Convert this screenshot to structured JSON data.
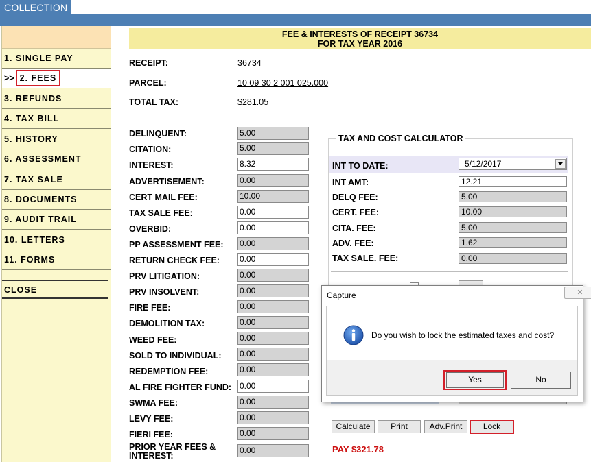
{
  "app_tab": "COLLECTION",
  "sidebar": {
    "items": [
      {
        "label": "1. SINGLE PAY"
      },
      {
        "prefix": ">>",
        "label": "2. FEES"
      },
      {
        "label": "3. REFUNDS"
      },
      {
        "label": "4. TAX BILL"
      },
      {
        "label": "5. HISTORY"
      },
      {
        "label": "6. ASSESSMENT"
      },
      {
        "label": "7. TAX SALE"
      },
      {
        "label": "8. DOCUMENTS"
      },
      {
        "label": "9. AUDIT TRAIL"
      },
      {
        "label": "10. LETTERS"
      },
      {
        "label": "11. FORMS"
      }
    ],
    "close_label": "CLOSE"
  },
  "header": {
    "line1": "FEE & INTERESTS OF RECEIPT 36734",
    "line2": "FOR TAX YEAR 2016"
  },
  "info": {
    "receipt_label": "RECEIPT:",
    "receipt_value": "36734",
    "parcel_label": "PARCEL:",
    "parcel_value": "10 09 30 2 001 025.000",
    "total_tax_label": "TOTAL TAX:",
    "total_tax_value": "$281.05"
  },
  "fees": [
    {
      "label": "DELINQUENT:",
      "value": "5.00"
    },
    {
      "label": "CITATION:",
      "value": "5.00"
    },
    {
      "label": "INTEREST:",
      "value": "8.32"
    },
    {
      "label": "ADVERTISEMENT:",
      "value": "0.00"
    },
    {
      "label": "CERT MAIL FEE:",
      "value": "10.00"
    },
    {
      "label": "TAX SALE FEE:",
      "value": "0.00"
    },
    {
      "label": "OVERBID:",
      "value": "0.00"
    },
    {
      "label": "PP ASSESSMENT FEE:",
      "value": "0.00"
    },
    {
      "label": "RETURN CHECK FEE:",
      "value": "0.00"
    },
    {
      "label": "PRV LITIGATION:",
      "value": "0.00"
    },
    {
      "label": "PRV INSOLVENT:",
      "value": "0.00"
    },
    {
      "label": "FIRE FEE:",
      "value": "0.00"
    },
    {
      "label": "DEMOLITION TAX:",
      "value": "0.00"
    },
    {
      "label": "WEED FEE:",
      "value": "0.00"
    },
    {
      "label": "SOLD TO INDIVIDUAL:",
      "value": "0.00"
    },
    {
      "label": "REDEMPTION FEE:",
      "value": "0.00"
    },
    {
      "label": "AL FIRE FIGHTER FUND:",
      "value": "0.00"
    },
    {
      "label": "SWMA FEE:",
      "value": "0.00"
    },
    {
      "label": "LEVY FEE:",
      "value": "0.00"
    },
    {
      "label": "FIERI FEE:",
      "value": "0.00"
    },
    {
      "label": "PRIOR YEAR FEES &",
      "label2": "INTEREST:",
      "value": "0.00"
    }
  ],
  "calculator": {
    "title": "TAX AND COST CALCULATOR",
    "int_to_date_label": "INT TO DATE:",
    "int_to_date_value": "5/12/2017",
    "rows": [
      {
        "label": "INT AMT:",
        "value": "12.21"
      },
      {
        "label": "DELQ FEE:",
        "value": "5.00"
      },
      {
        "label": "CERT. FEE:",
        "value": "10.00"
      },
      {
        "label": "CITA. FEE:",
        "value": "5.00"
      },
      {
        "label": "ADV. FEE:",
        "value": "1.62"
      },
      {
        "label": "TAX SALE. FEE:",
        "value": "0.00"
      }
    ],
    "buttons": {
      "calculate": "Calculate",
      "print": "Print",
      "adv_print": "Adv.Print",
      "lock": "Lock"
    },
    "pay_label": "PAY $321.78"
  },
  "dialog": {
    "title": "Capture",
    "message": "Do you wish to lock the estimated taxes and cost?",
    "yes_label": "Yes",
    "no_label": "No",
    "close_glyph": "✕"
  },
  "colors": {
    "tab_blue": "#4d7fb4",
    "sidebar_bg": "#fbf8cc",
    "header_bg": "#f5ec9e",
    "highlight_red": "#d3202a",
    "pay_red": "#cc1111"
  }
}
